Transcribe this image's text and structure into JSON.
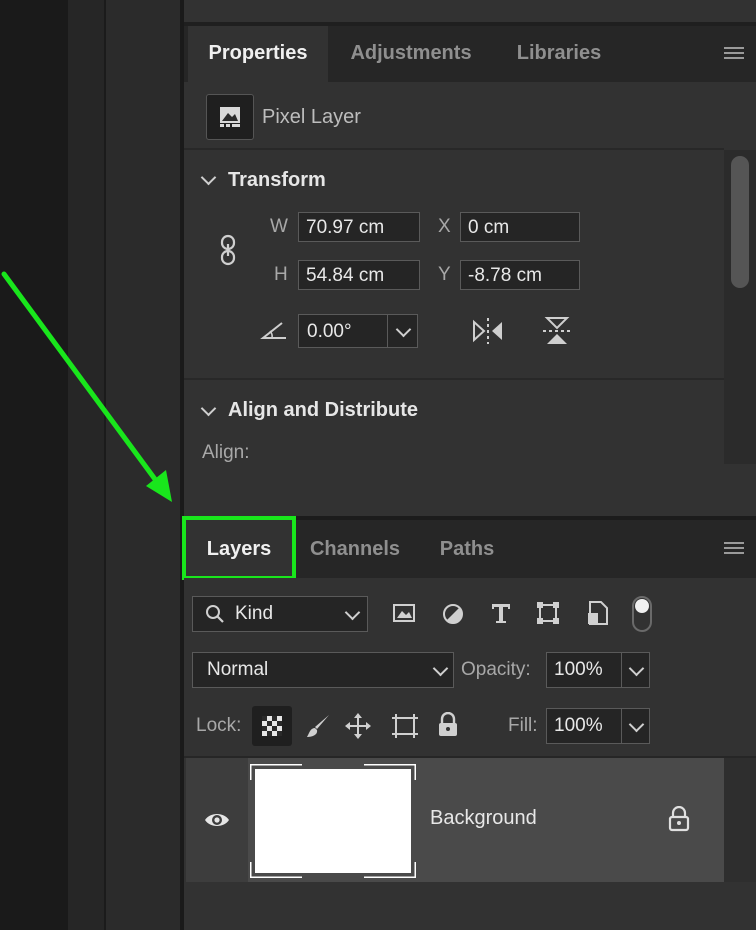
{
  "properties_panel": {
    "tabs": [
      "Properties",
      "Adjustments",
      "Libraries"
    ],
    "active_tab": "Properties",
    "layer_type": "Pixel Layer",
    "transform": {
      "title": "Transform",
      "w_label": "W",
      "w_value": "70.97 cm",
      "h_label": "H",
      "h_value": "54.84 cm",
      "x_label": "X",
      "x_value": "0 cm",
      "y_label": "Y",
      "y_value": "-8.78 cm",
      "angle_value": "0.00°"
    },
    "align": {
      "title": "Align and Distribute",
      "align_label": "Align:"
    }
  },
  "layers_panel": {
    "tabs": [
      "Layers",
      "Channels",
      "Paths"
    ],
    "active_tab": "Layers",
    "filter_kind": "Kind",
    "blend_mode": "Normal",
    "opacity_label": "Opacity:",
    "opacity_value": "100%",
    "lock_label": "Lock:",
    "fill_label": "Fill:",
    "fill_value": "100%",
    "layers": [
      {
        "name": "Background",
        "visible": true,
        "locked": true
      }
    ]
  },
  "colors": {
    "highlight": "#19e61c",
    "panel_bg": "#323232",
    "tabbar_bg": "#262626"
  }
}
